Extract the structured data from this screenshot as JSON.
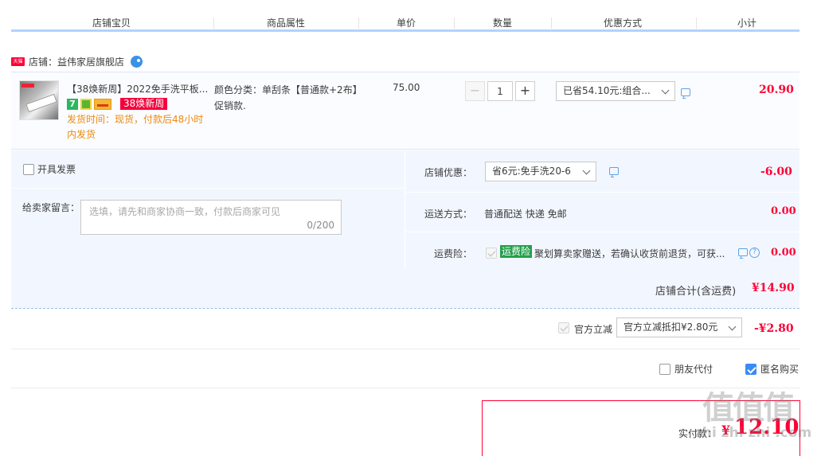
{
  "columns": [
    "店铺宝贝",
    "商品属性",
    "单价",
    "数量",
    "优惠方式",
    "小计"
  ],
  "shop": {
    "badge": "天猫",
    "label": "店铺：益伟家居旗舰店"
  },
  "item": {
    "title": "【38焕新周】2022免手洗平板...",
    "badge_7": "7",
    "badge_38": "38焕新周",
    "shipping": "发货时间：现货，付款后48小时内发货",
    "attributes": "颜色分类：单刮条【普通款+2布】促销款.",
    "unit_price": "75.00",
    "quantity": "1",
    "qty_minus": "−",
    "qty_plus": "+",
    "discount_option": "已省54.10元:组合...",
    "subtotal": "20.90"
  },
  "invoice_label": "开具发票",
  "message": {
    "label": "给卖家留言：",
    "placeholder": "选填，请先和商家协商一致，付款后商家可见",
    "counter": "0/200"
  },
  "shop_discount": {
    "label": "店铺优惠：",
    "option": "省6元:免手洗20-6",
    "amount": "-6.00"
  },
  "delivery": {
    "label": "运送方式：",
    "value": "普通配送 快递 免邮",
    "amount": "0.00"
  },
  "insurance": {
    "label": "运费险：",
    "tag": "运费险",
    "text": "聚划算卖家赠送，若确认收货前退货，可获...",
    "help": "?",
    "amount": "0.00"
  },
  "shop_total": {
    "label": "店铺合计(含运费)",
    "amount": "¥14.90"
  },
  "official": {
    "label": "官方立减",
    "option": "官方立减抵扣¥2.80元",
    "amount": "-¥2.80"
  },
  "friend_pay": "朋友代付",
  "anonymous": "匿名购买",
  "final": {
    "label": "实付款：",
    "currency": "¥",
    "amount": "12.10"
  },
  "watermark": {
    "main": "值值值",
    "sub": "zhi zhi zhi .com"
  }
}
